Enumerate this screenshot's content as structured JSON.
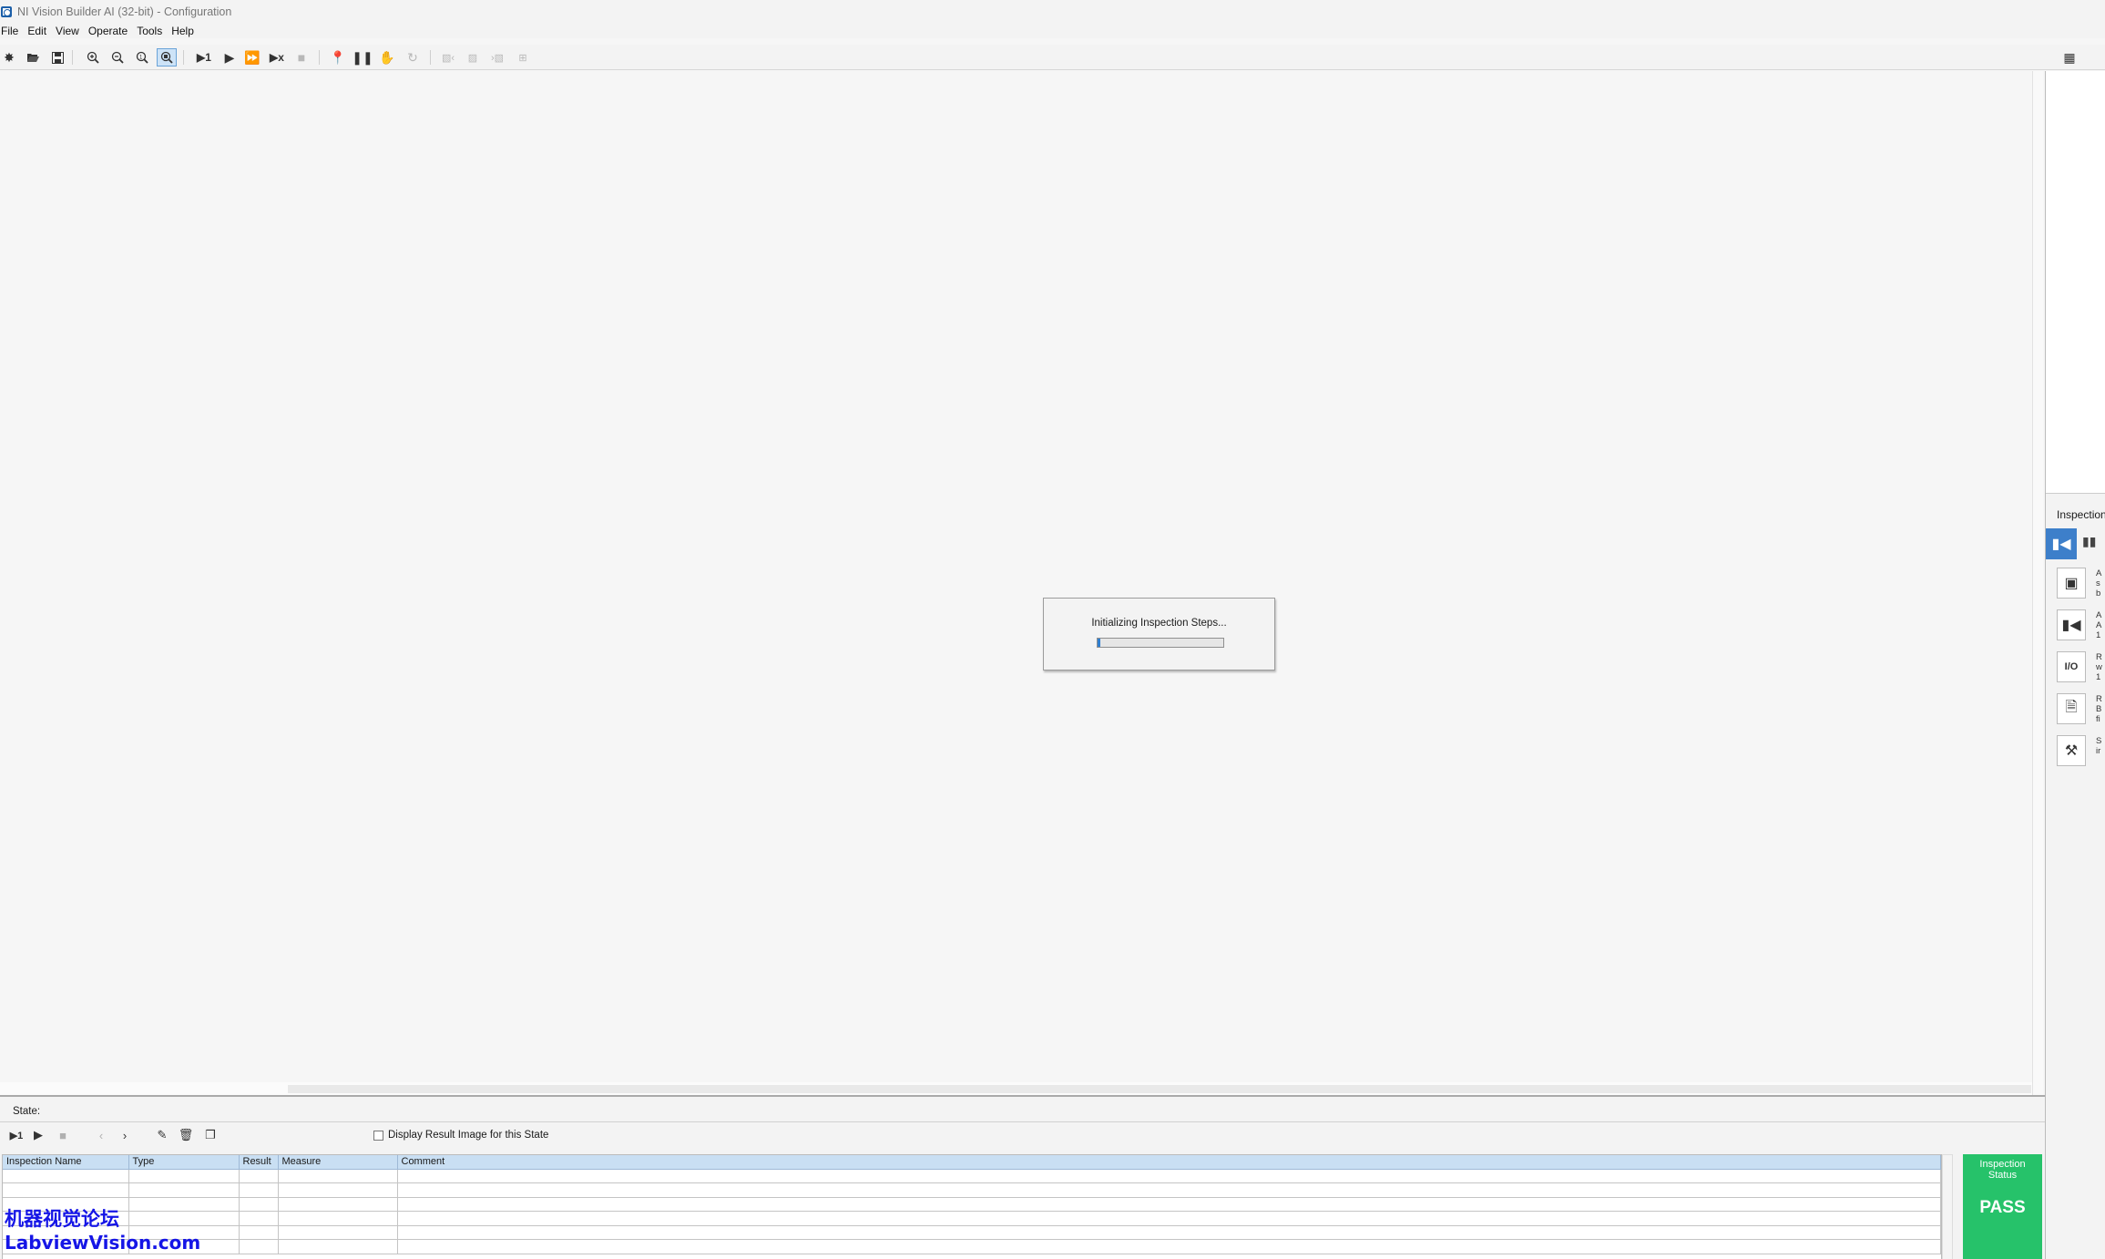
{
  "window": {
    "title": "NI Vision Builder AI (32-bit) - Configuration"
  },
  "menu": {
    "items": [
      "File",
      "Edit",
      "View",
      "Operate",
      "Tools",
      "Help"
    ]
  },
  "toolbar": {
    "icons": {
      "new": "star-icon",
      "open": "folder-open-icon",
      "save": "floppy-disk-icon",
      "zoom_in": "zoom-in-icon",
      "zoom_out": "zoom-out-icon",
      "zoom_fit": "zoom-fit-icon",
      "zoom_active": "zoom-active-icon",
      "run_once": "run-once-icon",
      "run": "play-icon",
      "run_continuous": "fast-forward-icon",
      "run_stop": "run-stop-icon",
      "stop": "stop-icon",
      "pin": "pin-icon",
      "pause": "pause-icon",
      "hand": "hand-icon",
      "reset": "reset-icon",
      "prev_image": "previous-image-icon",
      "image": "image-icon",
      "next_image": "next-image-icon",
      "hierarchy": "hierarchy-icon",
      "config": "configuration-view-icon"
    },
    "run_once_label": "▶1",
    "run_stop_label": "▶x"
  },
  "dialog": {
    "message": "Initializing Inspection Steps...",
    "progress": 0.02
  },
  "right_panel": {
    "title": "Inspection",
    "items": [
      {
        "icon": "acquire-image-icon",
        "text": "A\ns\nb"
      },
      {
        "icon": "acquire-image-1394-icon",
        "text": "A\nA\n1"
      },
      {
        "icon": "io-icon",
        "text": "R\nw\n1"
      },
      {
        "icon": "read-file-icon",
        "text": "R\nB\nfi"
      },
      {
        "icon": "simulate-icon",
        "text": "S\nir"
      }
    ]
  },
  "bottom": {
    "state_label": "State:",
    "run_once_label": "▶1",
    "checkbox_label": "Display Result Image for this State",
    "checkbox_checked": false,
    "columns": [
      "Inspection Name",
      "Type",
      "Result",
      "Measure",
      "Comment"
    ],
    "rows": [
      [
        "",
        "",
        "",
        "",
        ""
      ],
      [
        "",
        "",
        "",
        "",
        ""
      ],
      [
        "",
        "",
        "",
        "",
        ""
      ],
      [
        "",
        "",
        "",
        "",
        ""
      ],
      [
        "",
        "",
        "",
        "",
        ""
      ],
      [
        "",
        "",
        "",
        "",
        ""
      ]
    ],
    "status": {
      "title": "Inspection\nStatus",
      "value": "PASS",
      "color": "#26c26a"
    }
  },
  "watermark": {
    "line1": "机器视觉论坛",
    "line2": "LabviewVision.com"
  }
}
